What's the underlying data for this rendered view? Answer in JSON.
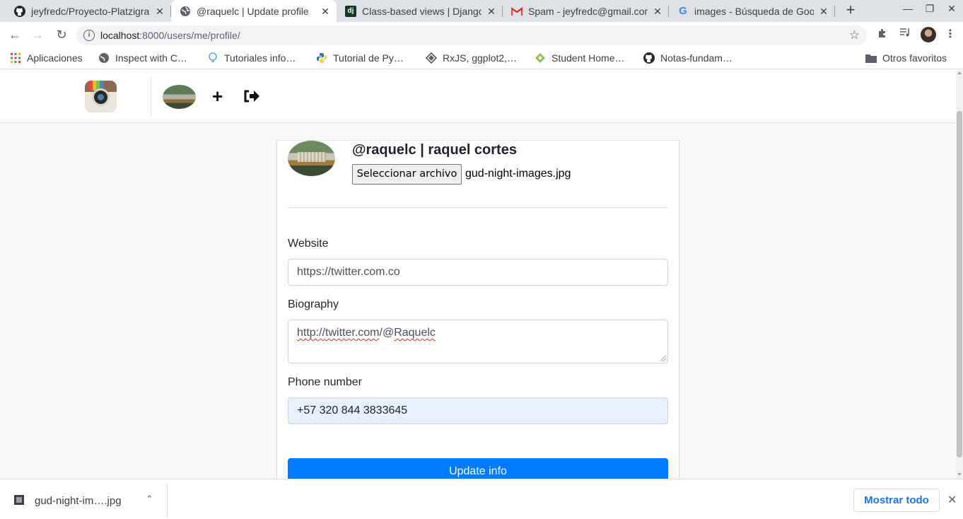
{
  "browser": {
    "tabs": [
      {
        "title": "jeyfredc/Proyecto-Platzigram",
        "icon": "github-icon"
      },
      {
        "title": "@raquelc | Update profile",
        "icon": "globe-icon"
      },
      {
        "title": "Class-based views | Django",
        "icon": "django-icon"
      },
      {
        "title": "Spam - jeyfredc@gmail.com",
        "icon": "gmail-icon"
      },
      {
        "title": "images - Búsqueda de Google",
        "icon": "google-icon"
      }
    ],
    "address": {
      "host": "localhost",
      "path": ":8000/users/me/profile/"
    },
    "bookmarks": [
      {
        "label": "Aplicaciones",
        "icon": "apps-grid-icon"
      },
      {
        "label": "Inspect with C…",
        "icon": "globe-icon"
      },
      {
        "label": "Tutoriales info…",
        "icon": "bulb-icon"
      },
      {
        "label": "Tutorial de Py…",
        "icon": "python-icon"
      },
      {
        "label": "RxJS, ggplot2,…",
        "icon": "diamond-icon"
      },
      {
        "label": "Student Home…",
        "icon": "leaf-icon"
      },
      {
        "label": "Notas-fundam…",
        "icon": "github-icon"
      }
    ],
    "other_bookmarks": "Otros favoritos"
  },
  "profile": {
    "username_line": "@raquelc | raquel cortes",
    "file_button": "Seleccionar archivo",
    "file_name": "gud-night-images.jpg",
    "website_label": "Website",
    "website_value": "https://twitter.com.co",
    "biography_label": "Biography",
    "biography_parts": [
      "http://",
      "twitter.com",
      "/@",
      "Raquelc"
    ],
    "phone_label": "Phone number",
    "phone_value": "+57 320 844 3833645",
    "submit_label": "Update info"
  },
  "downloads": {
    "file": "gud-night-im….jpg",
    "show_all": "Mostrar todo"
  },
  "colors": {
    "primary": "#007bff",
    "autofill": "#e8f0fe",
    "link": "#1a73e8"
  }
}
